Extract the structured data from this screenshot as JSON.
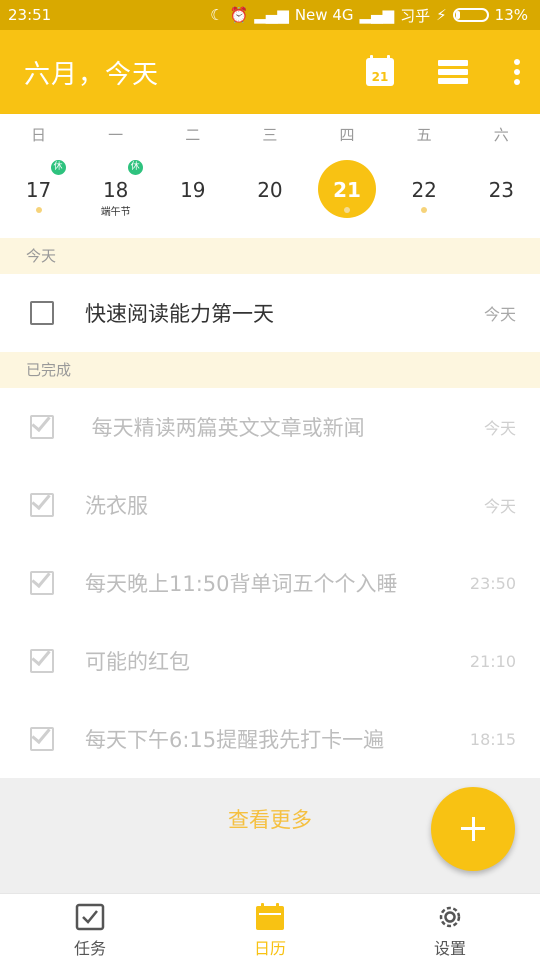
{
  "status_bar": {
    "time": "23:51",
    "network": "New 4G",
    "app_indicator": "习乎",
    "battery": "13%",
    "battery_level": 0.13
  },
  "app_bar": {
    "title": "六月，今天",
    "calendar_icon_day": "21"
  },
  "week": {
    "weekdays": [
      "日",
      "一",
      "二",
      "三",
      "四",
      "五",
      "六"
    ],
    "days": [
      {
        "date": "17",
        "badge": "休",
        "dot": true
      },
      {
        "date": "18",
        "badge": "休",
        "label": "端午节"
      },
      {
        "date": "19"
      },
      {
        "date": "20"
      },
      {
        "date": "21",
        "selected": true,
        "dot": true
      },
      {
        "date": "22",
        "dot": true
      },
      {
        "date": "23"
      }
    ]
  },
  "sections": {
    "today": {
      "header": "今天",
      "tasks": [
        {
          "title": "快速阅读能力第一天",
          "time": "今天",
          "done": false
        }
      ]
    },
    "completed": {
      "header": "已完成",
      "tasks": [
        {
          "title": " 每天精读两篇英文文章或新闻",
          "time": "今天",
          "done": true
        },
        {
          "title": "洗衣服",
          "time": "今天",
          "done": true
        },
        {
          "title": "每天晚上11:50背单词五个个入睡",
          "time": "23:50",
          "done": true
        },
        {
          "title": "可能的红包",
          "time": "21:10",
          "done": true
        },
        {
          "title": "每天下午6:15提醒我先打卡一遍",
          "time": "18:15",
          "done": true
        }
      ]
    }
  },
  "more": "查看更多",
  "bottom_nav": [
    {
      "label": "任务",
      "icon": "checkbox-icon",
      "active": false
    },
    {
      "label": "日历",
      "icon": "calendar-icon",
      "active": true
    },
    {
      "label": "设置",
      "icon": "gear-icon",
      "active": false
    }
  ],
  "colors": {
    "accent": "#f8c213",
    "status_bar": "#d9a900",
    "section_bg": "#fdf6df",
    "holiday_badge": "#2ec27e"
  }
}
